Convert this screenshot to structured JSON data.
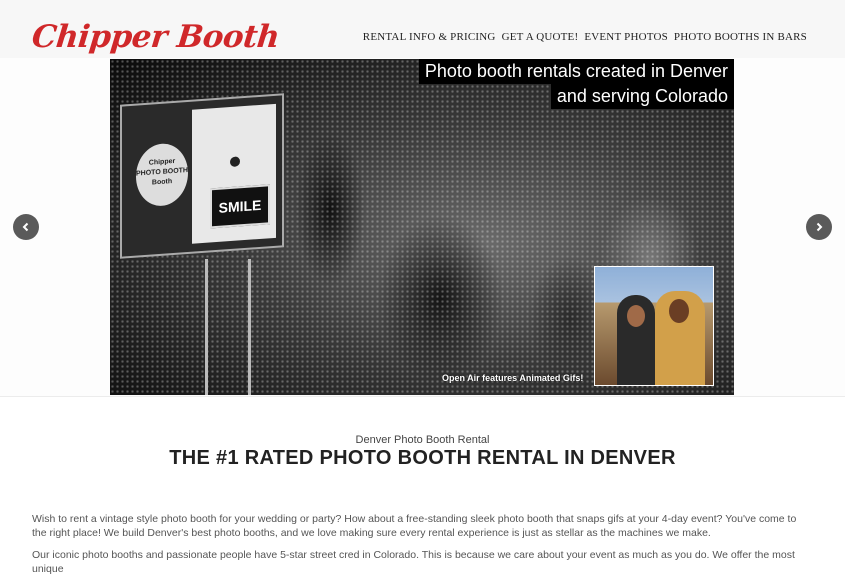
{
  "brand": {
    "logo_text": "Chipper Booth",
    "logo_color": "#d0282a"
  },
  "nav": {
    "items": [
      {
        "label": "RENTAL INFO & PRICING"
      },
      {
        "label": "GET A QUOTE!"
      },
      {
        "label": "EVENT PHOTOS"
      },
      {
        "label": "PHOTO BOOTHS IN BARS"
      }
    ]
  },
  "slider": {
    "caption_line1": "Photo booth rentals created in Denver",
    "caption_line2": "and serving Colorado",
    "booth_sign": "SMILE",
    "booth_disc_text": "Chipper PHOTO BOOTH Booth",
    "inset_caption": "Open Air features Animated Gifs!",
    "prev_icon": "chevron-left-icon",
    "next_icon": "chevron-right-icon"
  },
  "section": {
    "subtitle": "Denver Photo Booth Rental",
    "title": "THE #1 RATED PHOTO BOOTH RENTAL IN DENVER",
    "paragraph1": "Wish to rent a vintage style photo booth for your wedding or party? How about a free-standing sleek photo booth that snaps gifs at your 4-day event? You've come to the right place! We build Denver's best photo booths, and we love making sure every rental experience is just as stellar as the machines we make.",
    "paragraph2": "Our iconic photo booths and passionate people have 5-star street cred in Colorado. This is because we care about your event as much as you do. We offer the most unique"
  }
}
